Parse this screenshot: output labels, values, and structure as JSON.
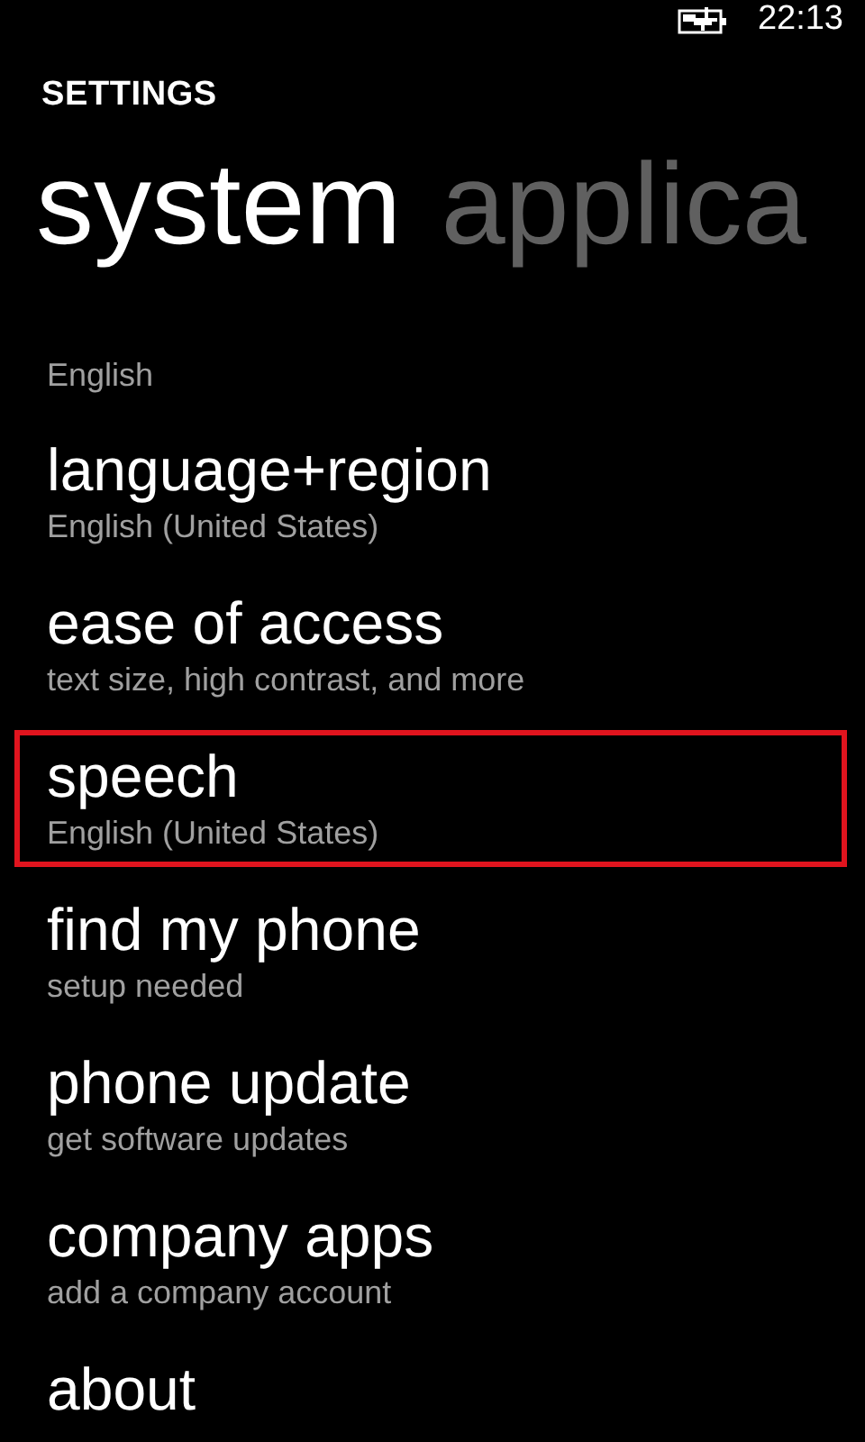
{
  "status_bar": {
    "time": "22:13"
  },
  "app_title": "SETTINGS",
  "pivots": [
    {
      "label": "system",
      "selected": true
    },
    {
      "label": "applica",
      "selected": false
    }
  ],
  "items": [
    {
      "subtitle": "English",
      "highlighted": false
    },
    {
      "title": "language+region",
      "subtitle": "English (United States)",
      "highlighted": false
    },
    {
      "title": "ease of access",
      "subtitle": "text size, high contrast, and more",
      "highlighted": false
    },
    {
      "title": "speech",
      "subtitle": "English (United States)",
      "highlighted": true
    },
    {
      "title": "find my phone",
      "subtitle": "setup needed",
      "highlighted": false
    },
    {
      "title": "phone update",
      "subtitle": "get software updates",
      "highlighted": false
    },
    {
      "title": "company apps",
      "subtitle": "add a company account",
      "highlighted": false
    },
    {
      "title": "about",
      "highlighted": false
    }
  ]
}
